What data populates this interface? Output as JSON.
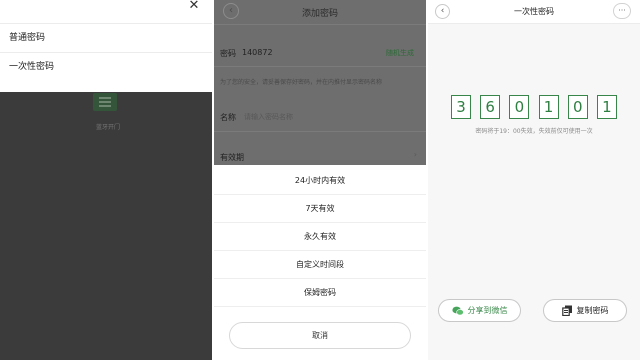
{
  "panel1": {
    "close_glyph": "✕",
    "menu_items": [
      "普通密码",
      "一次性密码"
    ],
    "overlay_label": "蓝牙开门"
  },
  "panel2": {
    "back_glyph": "‹",
    "title": "添加密码",
    "password_label": "密码",
    "password_value": "140872",
    "random_label": "随机生成",
    "hint": "为了您的安全，请妥善保存好密码，并在内推付显示密码名称",
    "name_label": "名称",
    "name_placeholder": "请输入密码名称",
    "validity_label": "有效期",
    "validity_chevron": "›",
    "options": [
      "24小时内有效",
      "7天有效",
      "永久有效",
      "自定义时间段",
      "保姆密码"
    ],
    "cancel_label": "取消"
  },
  "panel3": {
    "back_glyph": "‹",
    "title": "一次性密码",
    "more_glyph": "···",
    "digits": [
      "3",
      "6",
      "0",
      "1",
      "0",
      "1"
    ],
    "note": "密码将于19：00失效，失效前仅可使用一次",
    "share_label": "分享到微信",
    "copy_label": "复制密码",
    "accent_color": "#2f7f42"
  }
}
